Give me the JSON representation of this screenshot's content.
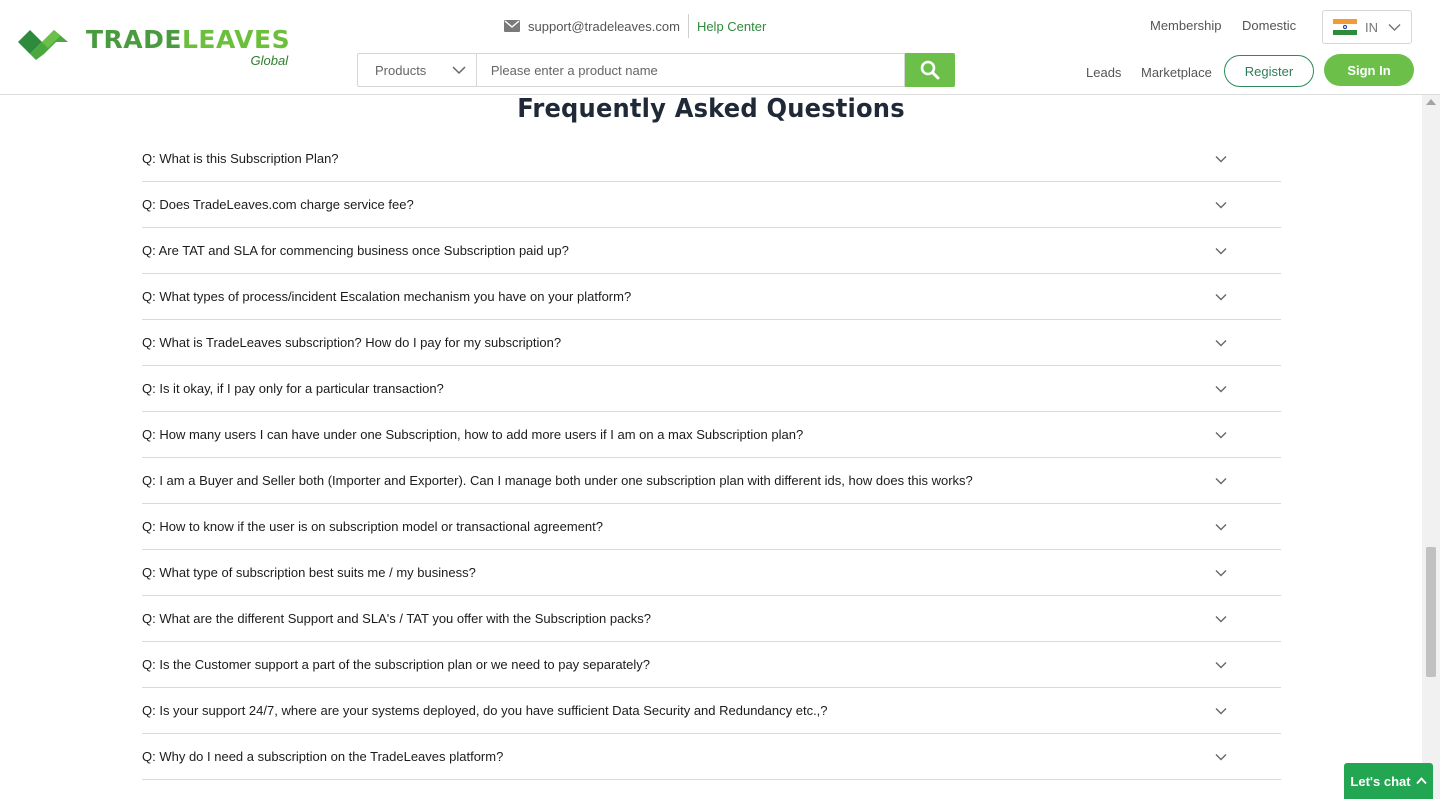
{
  "header": {
    "logo_word_part1": "TRADE",
    "logo_word_part2": "LEAVES",
    "logo_sub": "Global",
    "contact_email": "support@tradeleaves.com",
    "help_center": "Help Center",
    "membership": "Membership",
    "domestic": "Domestic",
    "country_code": "IN",
    "search_category": "Products",
    "search_placeholder": "Please enter a product name",
    "leads": "Leads",
    "marketplace": "Marketplace",
    "register": "Register",
    "sign_in": "Sign In",
    "brand_color": "#6cc04a"
  },
  "faq": {
    "title": "Frequently Asked Questions",
    "items": [
      "Q: What is this Subscription Plan?",
      "Q: Does TradeLeaves.com charge service fee?",
      "Q: Are TAT and SLA for commencing business once Subscription paid up?",
      "Q: What types of process/incident Escalation mechanism you have on your platform?",
      "Q: What is TradeLeaves subscription? How do I pay for my subscription?",
      "Q: Is it okay, if I pay only for a particular transaction?",
      "Q: How many users I can have under one Subscription, how to add more users if I am on a max Subscription plan?",
      "Q: I am a Buyer and Seller both (Importer and Exporter). Can I manage both under one subscription plan with different ids, how does this works?",
      "Q: How to know if the user is on subscription model or transactional agreement?",
      "Q: What type of subscription best suits me / my business?",
      "Q: What are the different Support and SLA's / TAT you offer with the Subscription packs?",
      "Q: Is the Customer support a part of the subscription plan or we need to pay separately?",
      "Q: Is your support 24/7, where are your systems deployed, do you have sufficient Data Security and Redundancy etc.,?",
      "Q: Why do I need a subscription on the TradeLeaves platform?"
    ]
  },
  "chat": {
    "label": "Let's chat"
  }
}
